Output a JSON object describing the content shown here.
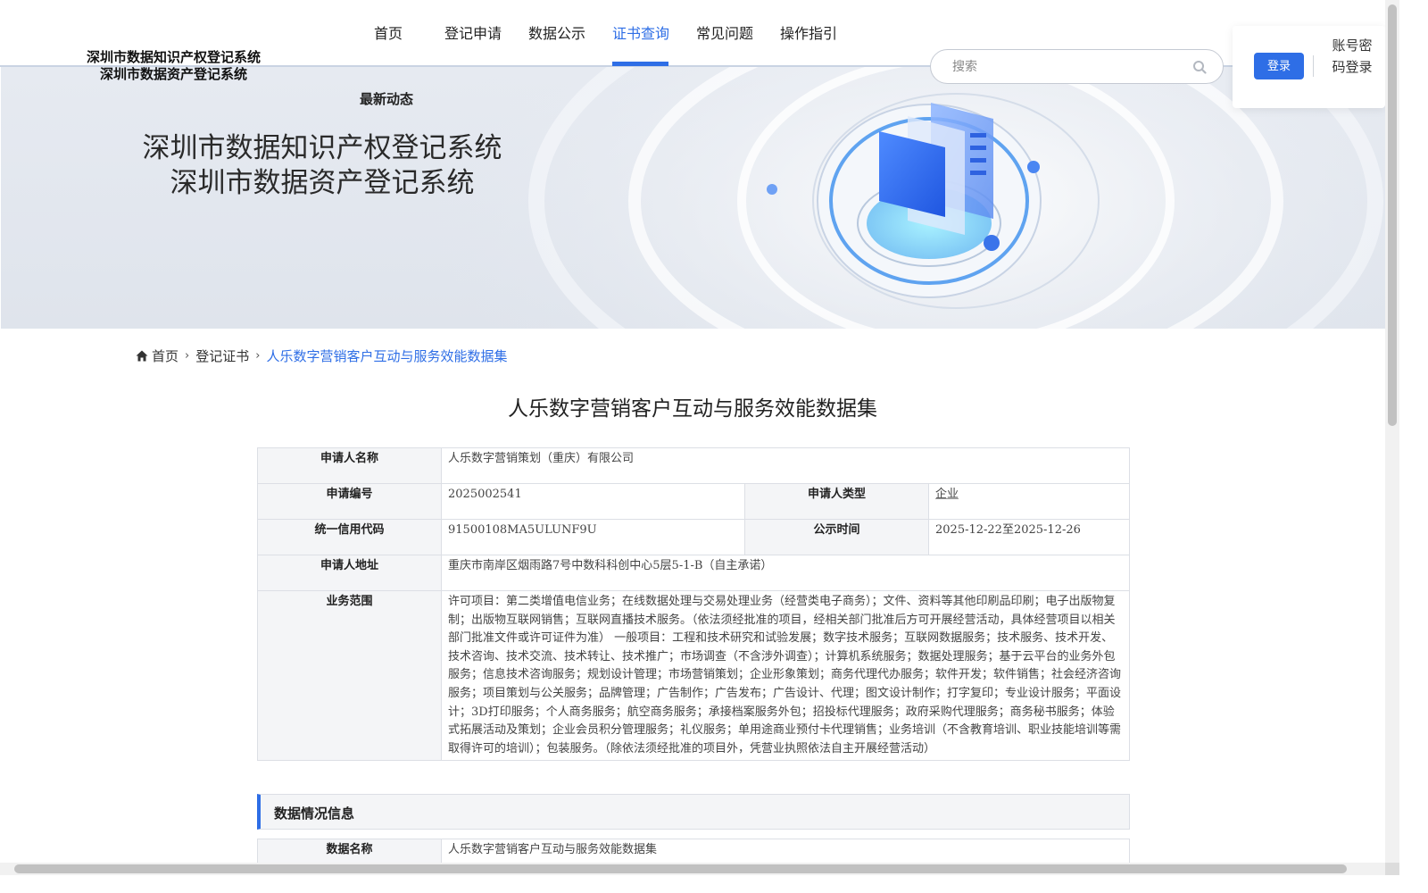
{
  "header": {
    "logo_line1": "深圳市数据知识产权登记系统",
    "logo_line2": "深圳市数据资产登记系统",
    "nav": [
      {
        "label": "首页"
      },
      {
        "label": "登记申请"
      },
      {
        "label": "数据公示"
      },
      {
        "label": "证书查询"
      },
      {
        "label": "常见问题"
      },
      {
        "label": "操作指引"
      }
    ],
    "active_nav": "证书查询",
    "sub_nav": "最新动态",
    "search_placeholder": "搜索",
    "login_button": "登录",
    "login_link": "账号密码登录"
  },
  "banner": {
    "title_line1": "深圳市数据知识产权登记系统",
    "title_line2": "深圳市数据资产登记系统"
  },
  "breadcrumb": {
    "home": "首页",
    "level2": "登记证书",
    "current": "人乐数字营销客户互动与服务效能数据集"
  },
  "page_title": "人乐数字营销客户互动与服务效能数据集",
  "applicant": {
    "name_label": "申请人名称",
    "name_value": "人乐数字营销策划（重庆）有限公司",
    "app_no_label": "申请编号",
    "app_no_value": "2025002541",
    "type_label": "申请人类型",
    "type_value": "企业",
    "credit_label": "统一信用代码",
    "credit_value": "91500108MA5ULUNF9U",
    "publicity_label": "公示时间",
    "publicity_value": "2025-12-22至2025-12-26",
    "address_label": "申请人地址",
    "address_value": "重庆市南岸区烟雨路7号中数科科创中心5层5-1-B（自主承诺）",
    "scope_label": "业务范围",
    "scope_value": "许可项目：第二类增值电信业务；在线数据处理与交易处理业务（经营类电子商务）；文件、资料等其他印刷品印刷；电子出版物复制；出版物互联网销售；互联网直播技术服务。（依法须经批准的项目，经相关部门批准后方可开展经营活动，具体经营项目以相关部门批准文件或许可证件为准） 一般项目：工程和技术研究和试验发展；数字技术服务；互联网数据服务；技术服务、技术开发、技术咨询、技术交流、技术转让、技术推广；市场调查（不含涉外调查）；计算机系统服务；数据处理服务；基于云平台的业务外包服务；信息技术咨询服务；规划设计管理；市场营销策划；企业形象策划；商务代理代办服务；软件开发；软件销售；社会经济咨询服务；项目策划与公关服务；品牌管理；广告制作；广告发布；广告设计、代理；图文设计制作；打字复印；专业设计服务；平面设计；3D打印服务；个人商务服务；航空商务服务；承接档案服务外包；招投标代理服务；政府采购代理服务；商务秘书服务；体验式拓展活动及策划；企业会员积分管理服务；礼仪服务；单用途商业预付卡代理销售；业务培训（不含教育培训、职业技能培训等需取得许可的培训）；包装服务。（除依法须经批准的项目外，凭营业执照依法自主开展经营活动）"
  },
  "data_section": {
    "title": "数据情况信息",
    "data_name_label": "数据名称",
    "data_name_value": "人乐数字营销客户互动与服务效能数据集"
  },
  "colors": {
    "accent": "#2e6ee6",
    "label_bg": "#f4f5f7",
    "border": "#dcdfe5"
  }
}
